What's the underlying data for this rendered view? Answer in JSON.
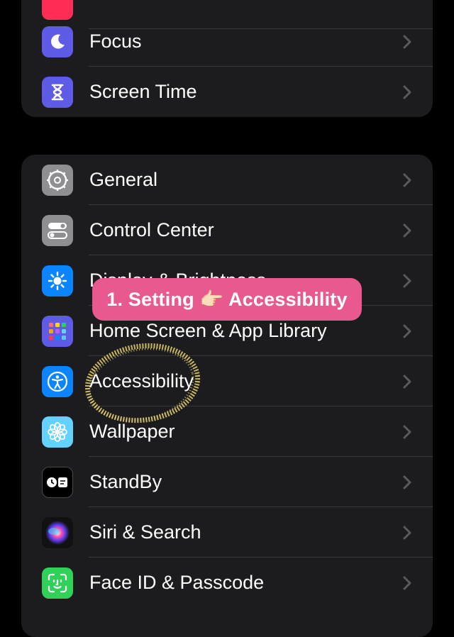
{
  "groups": {
    "top": [
      {
        "label": "",
        "color": "#ff2d55",
        "icon": "screen-time-notifications-icon"
      },
      {
        "label": "Focus",
        "color": "#5e5ce6",
        "icon": "moon-icon"
      },
      {
        "label": "Screen Time",
        "color": "#5e5ce6",
        "icon": "hourglass-icon"
      }
    ],
    "main": [
      {
        "label": "General",
        "color": "#8e8e93",
        "icon": "gear-icon"
      },
      {
        "label": "Control Center",
        "color": "#8e8e93",
        "icon": "toggles-icon"
      },
      {
        "label": "Display & Brightness",
        "color": "#0a84ff",
        "icon": "sun-icon"
      },
      {
        "label": "Home Screen & App Library",
        "color": "#5e5ce6",
        "icon": "app-grid-icon"
      },
      {
        "label": "Accessibility",
        "color": "#0a84ff",
        "icon": "accessibility-icon"
      },
      {
        "label": "Wallpaper",
        "color": "#64d2ff",
        "icon": "flower-icon"
      },
      {
        "label": "StandBy",
        "color": "#000000",
        "icon": "standby-icon"
      },
      {
        "label": "Siri & Search",
        "color": "#1c1c1e",
        "icon": "siri-icon"
      },
      {
        "label": "Face ID & Passcode",
        "color": "#30d158",
        "icon": "face-id-icon"
      }
    ]
  },
  "annotation": {
    "badge_text": "1. Setting 👉🏻 Accessibility",
    "circle_color": "#e8d26a"
  },
  "colors": {
    "background": "#000000",
    "group": "#1c1c1e",
    "separator": "#38383a",
    "chevron": "#5a5a5e",
    "badge": "#e85a8f"
  }
}
